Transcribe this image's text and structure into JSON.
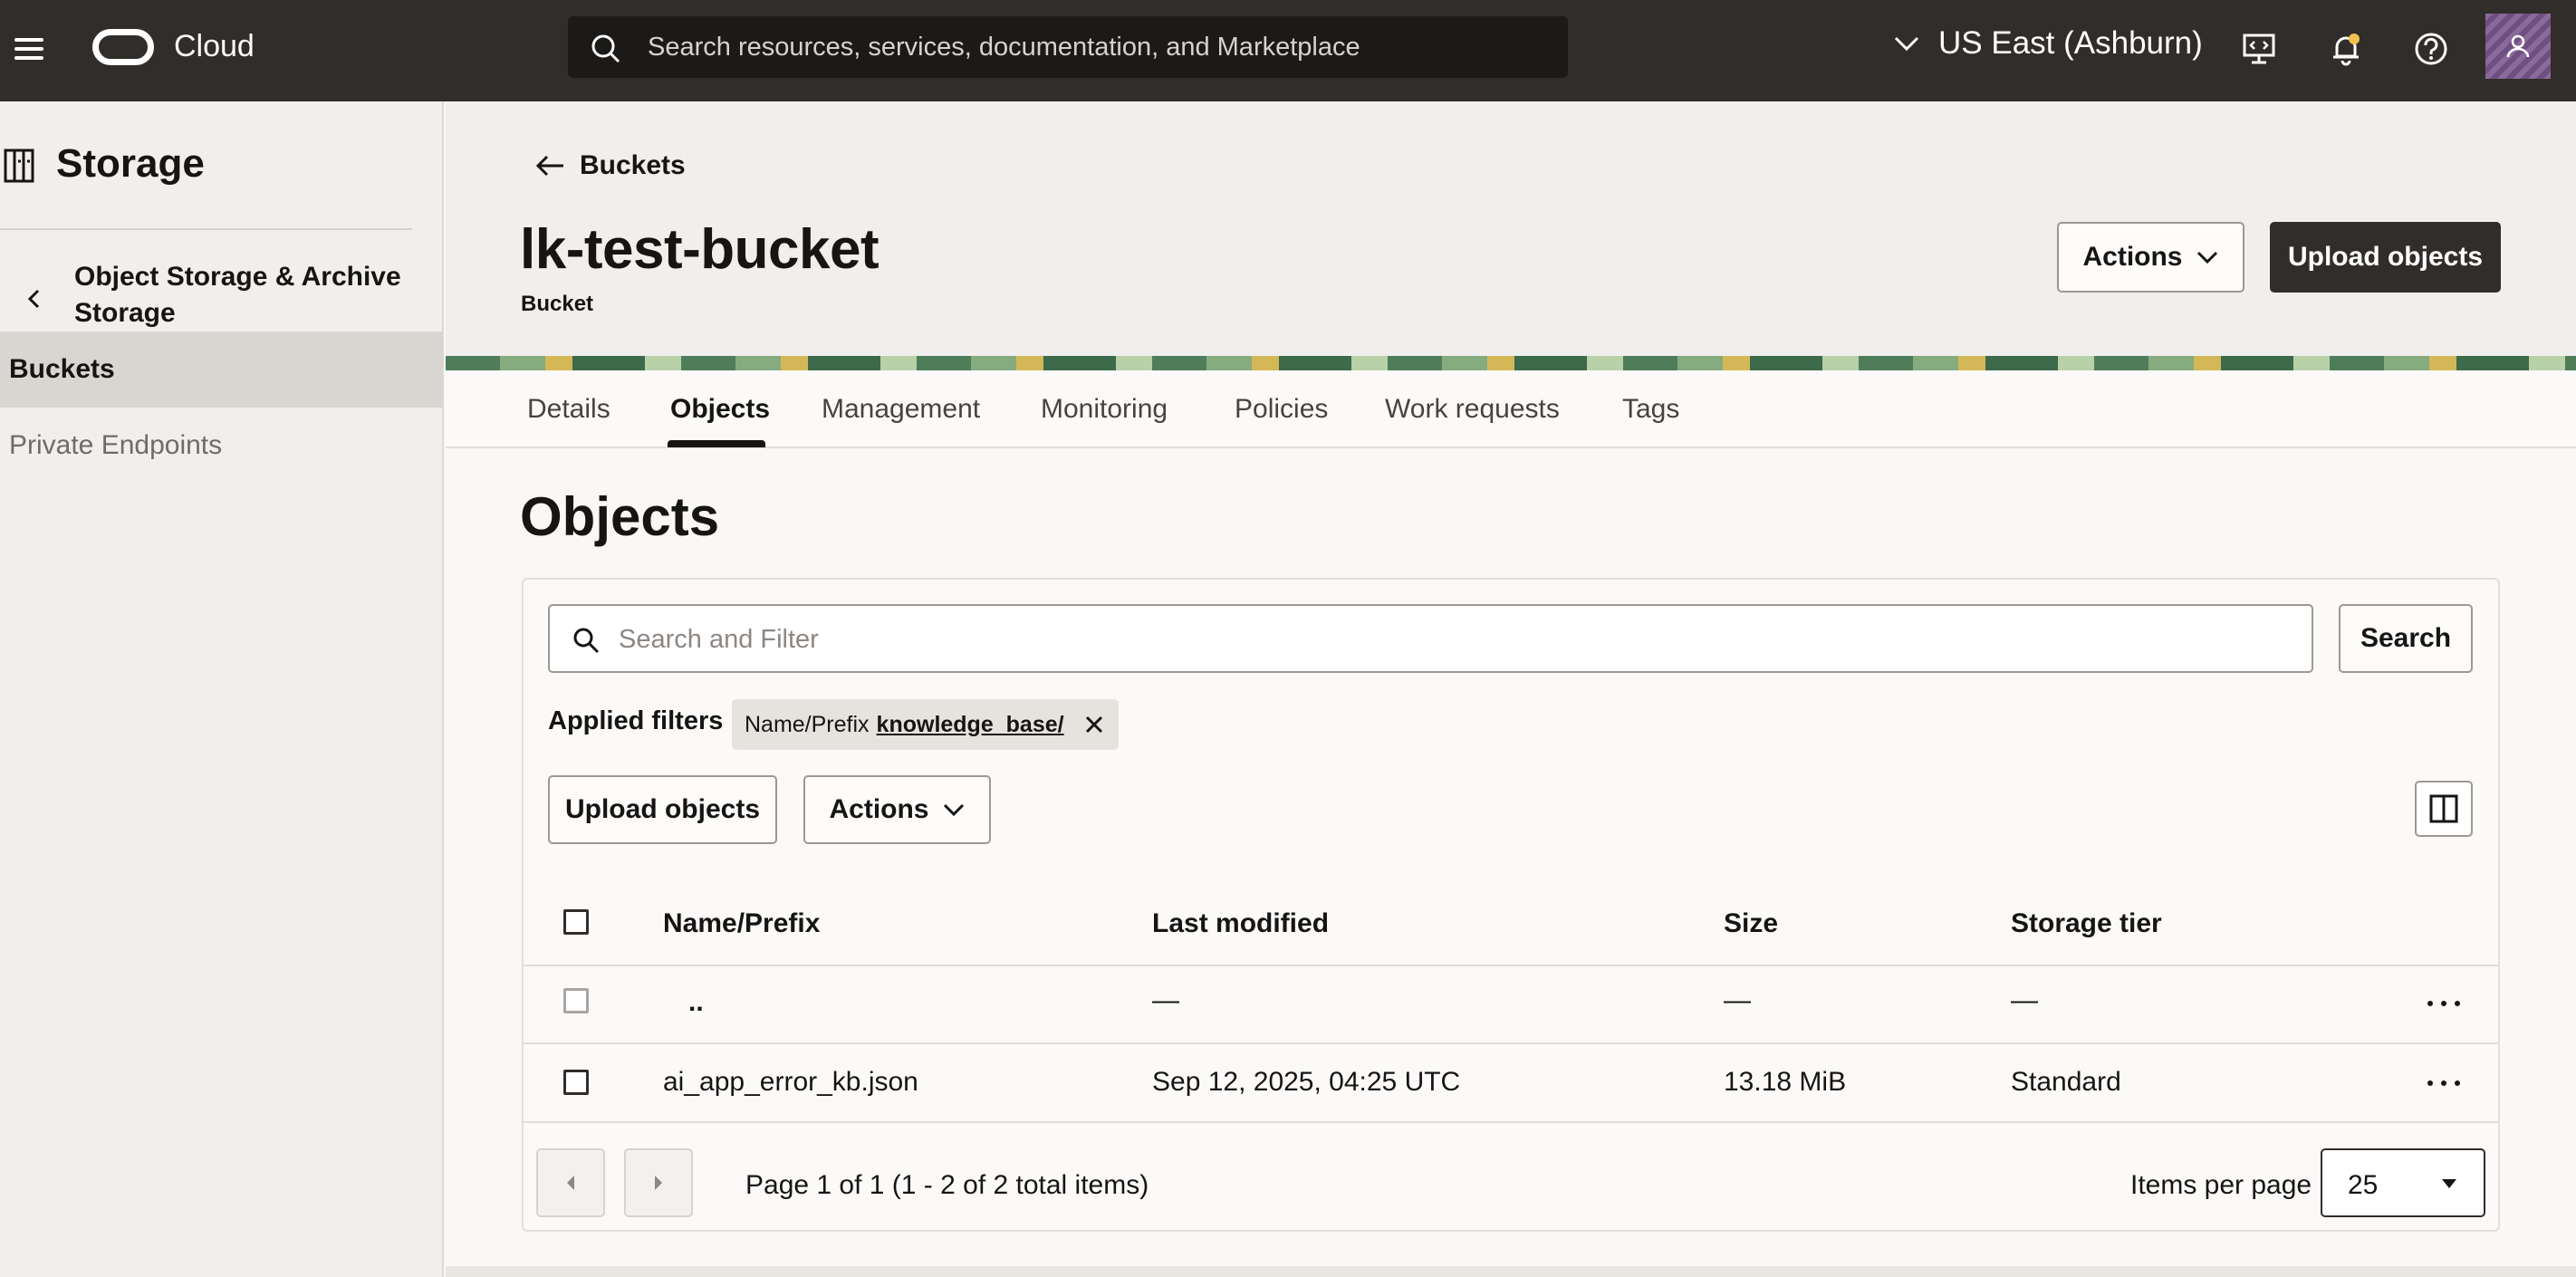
{
  "topbar": {
    "brand": "Cloud",
    "search_placeholder": "Search resources, services, documentation, and Marketplace",
    "region": "US East (Ashburn)"
  },
  "sidebar": {
    "title": "Storage",
    "section": "Object Storage & Archive Storage",
    "items": [
      {
        "label": "Buckets",
        "active": true
      },
      {
        "label": "Private Endpoints",
        "active": false
      }
    ]
  },
  "header": {
    "back_label": "Buckets",
    "title": "lk-test-bucket",
    "subtitle": "Bucket",
    "actions_label": "Actions",
    "upload_label": "Upload objects"
  },
  "tabs": [
    {
      "label": "Details"
    },
    {
      "label": "Objects",
      "active": true
    },
    {
      "label": "Management"
    },
    {
      "label": "Monitoring"
    },
    {
      "label": "Policies"
    },
    {
      "label": "Work requests"
    },
    {
      "label": "Tags"
    }
  ],
  "objects": {
    "title": "Objects",
    "filter_placeholder": "Search and Filter",
    "search_label": "Search",
    "applied_filters_label": "Applied filters",
    "chip": {
      "key": "Name/Prefix",
      "value": "knowledge_base/"
    },
    "upload_label": "Upload objects",
    "actions_label": "Actions",
    "columns": [
      "Name/Prefix",
      "Last modified",
      "Size",
      "Storage tier"
    ],
    "rows": [
      {
        "name": "..",
        "modified": "—",
        "size": "—",
        "tier": "—"
      },
      {
        "name": "ai_app_error_kb.json",
        "modified": "Sep 12, 2025, 04:25 UTC",
        "size": "13.18 MiB",
        "tier": "Standard"
      }
    ],
    "pagination": "Page 1 of 1 (1 - 2 of 2 total items)",
    "items_per_page_label": "Items per page",
    "items_per_page": "25"
  },
  "colors": {
    "topbar": "#312d2a",
    "primary_button": "#312d2a",
    "sidebar": "#f1efed"
  }
}
